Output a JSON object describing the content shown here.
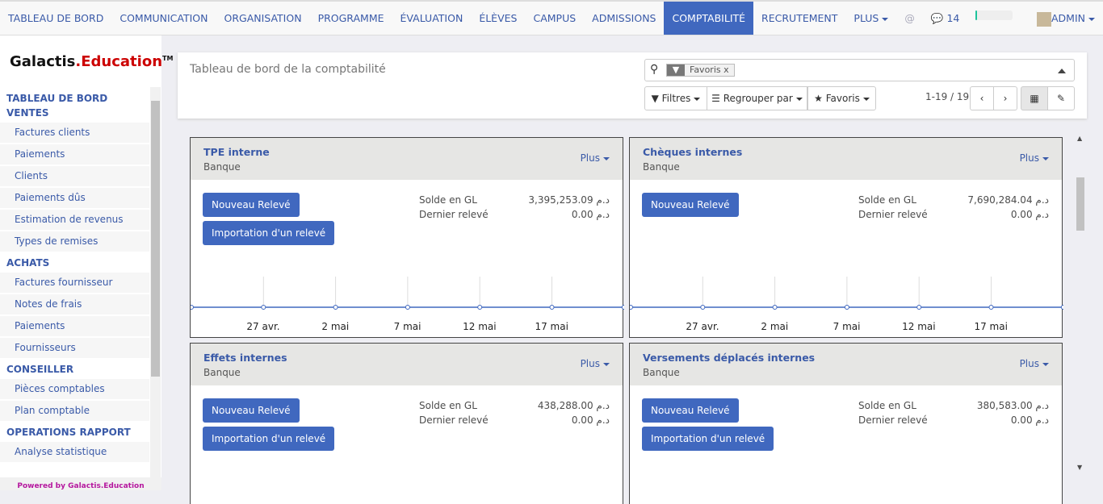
{
  "nav": {
    "items": [
      "TABLEAU DE BORD",
      "COMMUNICATION",
      "ORGANISATION",
      "PROGRAMME",
      "ÉVALUATION",
      "ÉLÈVES",
      "CAMPUS",
      "ADMISSIONS",
      "COMPTABILITÉ",
      "RECRUTEMENT"
    ],
    "active": "COMPTABILITÉ",
    "more": "PLUS",
    "at": "@",
    "messages": "14",
    "progress": 0.04,
    "user": "ADMIN",
    "accent": "#4068bf"
  },
  "sidebar": {
    "logo": "Galactis.Education",
    "sections": [
      {
        "title": "TABLEAU DE BORD VENTES",
        "items": [
          "Factures clients",
          "Paiements",
          "Clients",
          "Paiements dûs",
          "Estimation de revenus",
          "Types de remises"
        ]
      },
      {
        "title": "ACHATS",
        "items": [
          "Factures fournisseur",
          "Notes de frais",
          "Paiements",
          "Fournisseurs"
        ]
      },
      {
        "title": "CONSEILLER",
        "items": [
          "Pièces comptables",
          "Plan comptable"
        ]
      },
      {
        "title": "OPERATIONS RAPPORT",
        "items": [
          "Analyse statistique"
        ]
      }
    ],
    "powered": "Powered by Galactis.Education"
  },
  "control": {
    "title": "Tableau de bord de la comptabilité",
    "facet": "Favoris",
    "filters": "Filtres",
    "groupby": "Regrouper par",
    "favorites": "Favoris",
    "pager": "1-19 / 19"
  },
  "cards": [
    {
      "title": "TPE interne",
      "subtitle": "Banque",
      "more": "Plus",
      "btn1": "Nouveau Relevé",
      "btn2": "Importation d'un relevé",
      "gl_label": "Solde en GL",
      "gl": "3,395,253.09 د.م",
      "last_label": "Dernier relevé",
      "last": "0.00 د.م",
      "graph": true
    },
    {
      "title": "Chèques internes",
      "subtitle": "Banque",
      "more": "Plus",
      "btn1": "Nouveau Relevé",
      "gl_label": "Solde en GL",
      "gl": "7,690,284.04 د.م",
      "last_label": "Dernier relevé",
      "last": "0.00 د.م",
      "graph": true
    },
    {
      "title": "Effets internes",
      "subtitle": "Banque",
      "more": "Plus",
      "btn1": "Nouveau Relevé",
      "btn2": "Importation d'un relevé",
      "gl_label": "Solde en GL",
      "gl": "438,288.00 د.م",
      "last_label": "Dernier relevé",
      "last": "0.00 د.م",
      "graph": false
    },
    {
      "title": "Versements déplacés internes",
      "subtitle": "Banque",
      "more": "Plus",
      "btn1": "Nouveau Relevé",
      "btn2": "Importation d'un relevé",
      "gl_label": "Solde en GL",
      "gl": "380,583.00 د.م",
      "last_label": "Dernier relevé",
      "last": "0.00 د.م",
      "graph": false
    }
  ],
  "graph_ticks": [
    "27 avr.",
    "2 mai",
    "7 mai",
    "12 mai",
    "17 mai"
  ]
}
